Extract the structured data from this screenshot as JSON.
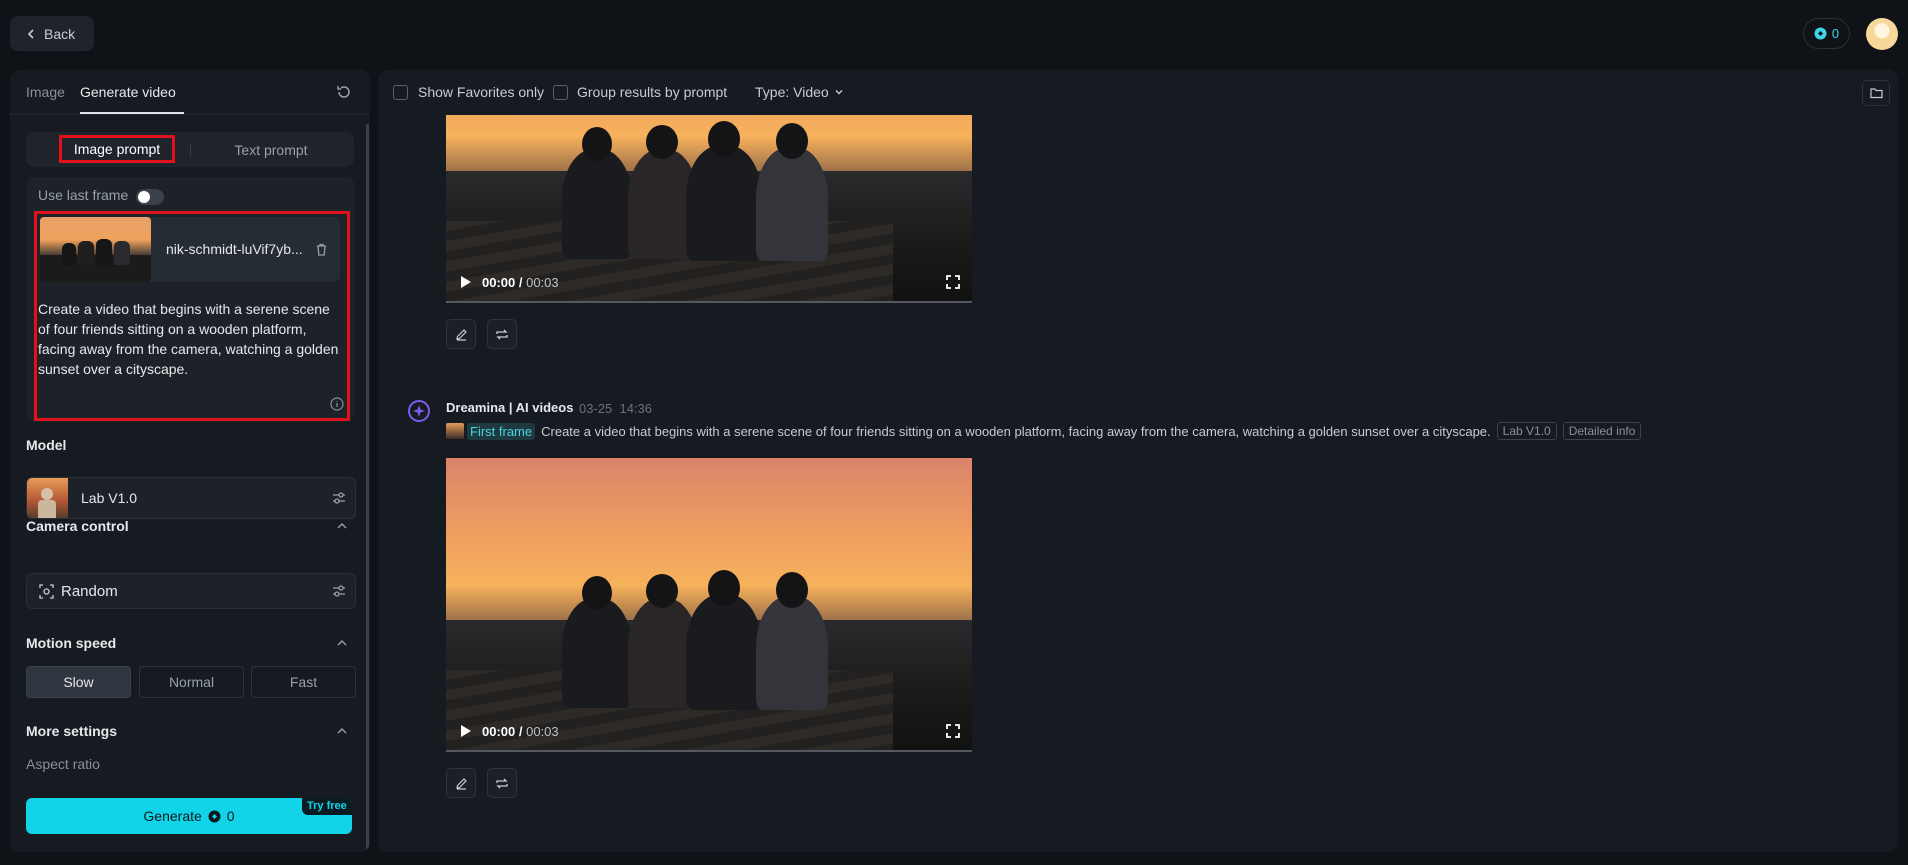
{
  "topbar": {
    "back_label": "Back",
    "credits": "0"
  },
  "left": {
    "tabs": [
      {
        "label": "Image"
      },
      {
        "label": "Generate video"
      }
    ],
    "prompt_modes": {
      "image": "Image prompt",
      "text": "Text prompt"
    },
    "use_last_frame_label": "Use last frame",
    "use_last_frame_on": false,
    "file_name": "nik-schmidt-luVif7yb...",
    "prompt_text": "Create a video that begins with a serene scene of four friends sitting on a wooden platform, facing away from the camera, watching a golden sunset over a cityscape.",
    "model_title": "Model",
    "model_name": "Lab V1.0",
    "camera_title": "Camera control",
    "camera_value": "Random",
    "motion_title": "Motion speed",
    "speeds": [
      "Slow",
      "Normal",
      "Fast"
    ],
    "selected_speed": "Slow",
    "more_settings_title": "More settings",
    "aspect_label": "Aspect ratio",
    "generate_label": "Generate",
    "generate_cost": "0",
    "try_free": "Try free"
  },
  "right": {
    "show_favorites_label": "Show Favorites only",
    "group_results_label": "Group results by prompt",
    "type_label": "Type: Video",
    "videos": [
      {
        "current": "00:00",
        "duration": "00:03"
      },
      {
        "current": "00:00",
        "duration": "00:03"
      }
    ],
    "result": {
      "author": "Dreamina | AI videos",
      "date": "03-25",
      "time": "14:36",
      "first_frame_label": "First frame",
      "prompt": "Create a video that begins with a serene scene of four friends sitting on a wooden platform, facing away from the camera, watching a golden sunset over a cityscape.",
      "model_tag": "Lab V1.0",
      "detail_tag": "Detailed info"
    }
  },
  "colors": {
    "accent": "#11d4e8",
    "highlight": "#e0101d",
    "panel": "#161a21",
    "background": "#0f1217"
  }
}
